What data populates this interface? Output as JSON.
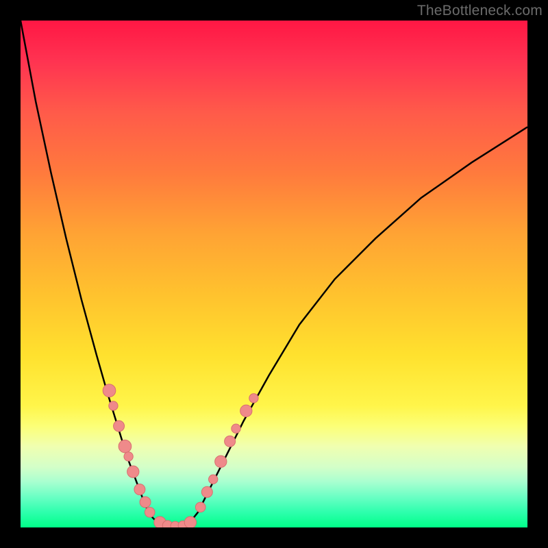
{
  "watermark": "TheBottleneck.com",
  "colors": {
    "background": "#000000",
    "curve": "#000000",
    "dot_fill": "#ef8a8a",
    "dot_stroke": "#d76f6f",
    "gradient_top": "#ff1744",
    "gradient_bottom": "#00ff88"
  },
  "chart_data": {
    "type": "line",
    "title": "",
    "xlabel": "",
    "ylabel": "",
    "xlim": [
      0,
      100
    ],
    "ylim": [
      0,
      100
    ],
    "grid": false,
    "legend": false,
    "series": [
      {
        "name": "left_curve",
        "x": [
          0,
          3,
          6,
          9,
          12,
          15,
          17,
          19,
          21,
          22.5,
          24,
          25,
          26,
          27,
          28
        ],
        "y": [
          100,
          84,
          70,
          57,
          45,
          34,
          27,
          20.5,
          14,
          10,
          6,
          3.5,
          2,
          1,
          0.5
        ]
      },
      {
        "name": "valley_floor",
        "x": [
          28,
          29,
          30,
          31,
          32,
          33
        ],
        "y": [
          0.5,
          0.2,
          0.1,
          0.1,
          0.2,
          0.5
        ]
      },
      {
        "name": "right_curve",
        "x": [
          33,
          35,
          37,
          40,
          44,
          49,
          55,
          62,
          70,
          79,
          89,
          100
        ],
        "y": [
          0.5,
          3,
          7,
          13,
          21,
          30,
          40,
          49,
          57,
          65,
          72,
          79
        ]
      }
    ],
    "annotations": {
      "dots": [
        {
          "x": 17.5,
          "y": 27,
          "r": 1.4
        },
        {
          "x": 18.3,
          "y": 24,
          "r": 1.0
        },
        {
          "x": 19.4,
          "y": 20,
          "r": 1.2
        },
        {
          "x": 20.6,
          "y": 16,
          "r": 1.4
        },
        {
          "x": 21.3,
          "y": 14,
          "r": 1.0
        },
        {
          "x": 22.2,
          "y": 11,
          "r": 1.3
        },
        {
          "x": 23.5,
          "y": 7.5,
          "r": 1.2
        },
        {
          "x": 24.6,
          "y": 5,
          "r": 1.2
        },
        {
          "x": 25.5,
          "y": 3,
          "r": 1.1
        },
        {
          "x": 27.5,
          "y": 1,
          "r": 1.3
        },
        {
          "x": 29,
          "y": 0.4,
          "r": 1.1
        },
        {
          "x": 30.5,
          "y": 0.3,
          "r": 1.0
        },
        {
          "x": 32,
          "y": 0.4,
          "r": 1.0
        },
        {
          "x": 33.5,
          "y": 1,
          "r": 1.3
        },
        {
          "x": 35.5,
          "y": 4,
          "r": 1.1
        },
        {
          "x": 36.8,
          "y": 7,
          "r": 1.2
        },
        {
          "x": 38,
          "y": 9.5,
          "r": 1.0
        },
        {
          "x": 39.5,
          "y": 13,
          "r": 1.3
        },
        {
          "x": 41.3,
          "y": 17,
          "r": 1.2
        },
        {
          "x": 42.5,
          "y": 19.5,
          "r": 1.0
        },
        {
          "x": 44.5,
          "y": 23,
          "r": 1.3
        },
        {
          "x": 46,
          "y": 25.5,
          "r": 1.0
        }
      ]
    }
  }
}
